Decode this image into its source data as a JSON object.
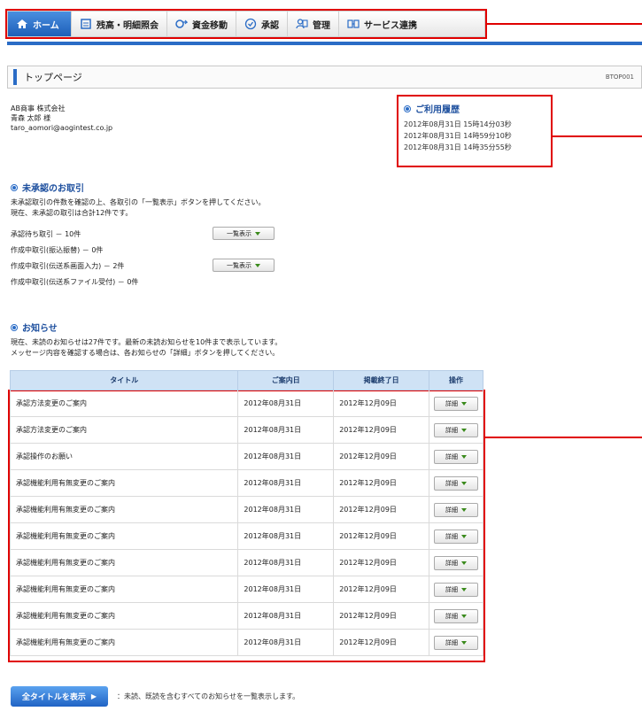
{
  "nav": {
    "items": [
      {
        "label": "ホーム",
        "icon": "home-icon"
      },
      {
        "label": "残高・明細照会",
        "icon": "document-icon"
      },
      {
        "label": "資金移動",
        "icon": "transfer-icon"
      },
      {
        "label": "承認",
        "icon": "check-circle-icon"
      },
      {
        "label": "管理",
        "icon": "users-icon"
      },
      {
        "label": "サービス連携",
        "icon": "service-link-icon"
      }
    ]
  },
  "page": {
    "title": "トップページ",
    "code": "BTOP001"
  },
  "user": {
    "company": "AB商事 株式会社",
    "name": "青森 太郎 様",
    "email": "taro_aomori@aogintest.co.jp"
  },
  "history": {
    "heading": "ご利用履歴",
    "entries": [
      "2012年08月31日 15時14分03秒",
      "2012年08月31日 14時59分10秒",
      "2012年08月31日 14時35分55秒"
    ]
  },
  "pending": {
    "heading": "未承認のお取引",
    "desc1": "未承認取引の件数を確認の上、各取引の「一覧表示」ボタンを押してください。",
    "desc2": "現在、未承認の取引は合計12件です。",
    "rows": [
      {
        "label": "承認待ち取引 － 10件",
        "button": "一覧表示"
      },
      {
        "label": "作成中取引(振込振替) － 0件",
        "button": ""
      },
      {
        "label": "作成中取引(伝送系画面入力) － 2件",
        "button": "一覧表示"
      },
      {
        "label": "作成中取引(伝送系ファイル受付) － 0件",
        "button": ""
      }
    ]
  },
  "notices": {
    "heading": "お知らせ",
    "desc1": "現在、未読のお知らせは27件です。最新の未読お知らせを10件まで表示しています。",
    "desc2": "メッセージ内容を確認する場合は、各お知らせの「詳細」ボタンを押してください。",
    "columns": [
      "タイトル",
      "ご案内日",
      "掲載終了日",
      "操作"
    ],
    "button_label": "詳細",
    "rows": [
      {
        "title": "承認方法変更のご案内",
        "date": "2012年08月31日",
        "end": "2012年12月09日"
      },
      {
        "title": "承認方法変更のご案内",
        "date": "2012年08月31日",
        "end": "2012年12月09日"
      },
      {
        "title": "承認操作のお願い",
        "date": "2012年08月31日",
        "end": "2012年12月09日"
      },
      {
        "title": "承認機能利用有無変更のご案内",
        "date": "2012年08月31日",
        "end": "2012年12月09日"
      },
      {
        "title": "承認機能利用有無変更のご案内",
        "date": "2012年08月31日",
        "end": "2012年12月09日"
      },
      {
        "title": "承認機能利用有無変更のご案内",
        "date": "2012年08月31日",
        "end": "2012年12月09日"
      },
      {
        "title": "承認機能利用有無変更のご案内",
        "date": "2012年08月31日",
        "end": "2012年12月09日"
      },
      {
        "title": "承認機能利用有無変更のご案内",
        "date": "2012年08月31日",
        "end": "2012年12月09日"
      },
      {
        "title": "承認機能利用有無変更のご案内",
        "date": "2012年08月31日",
        "end": "2012年12月09日"
      },
      {
        "title": "承認機能利用有無変更のご案内",
        "date": "2012年08月31日",
        "end": "2012年12月09日"
      }
    ]
  },
  "footer": {
    "show_all_label": "全タイトルを表示",
    "note": "：未読、既読を含むすべてのお知らせを一覧表示します。"
  },
  "colors": {
    "accent": "#2a6cc6",
    "callout": "#e00000",
    "table_header": "#cfe2f5"
  }
}
